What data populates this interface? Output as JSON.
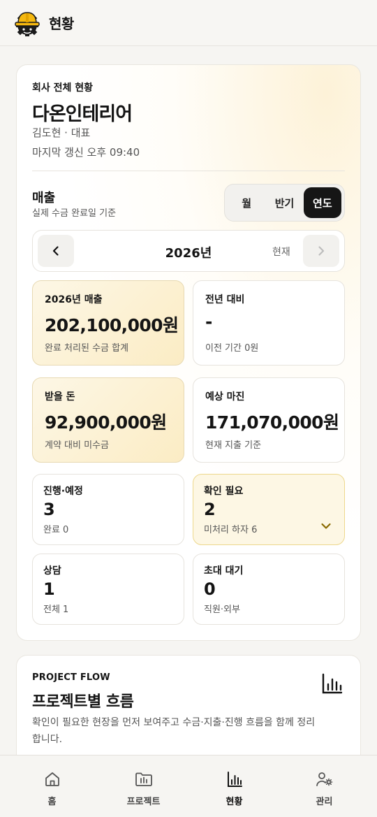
{
  "header": {
    "title": "현황",
    "logo_icon": "hardhat-gear-icon"
  },
  "overview": {
    "section_label": "회사 전체 현황",
    "company": "다온인테리어",
    "owner": "김도현 · 대표",
    "updated": "마지막 갱신 오후 09:40"
  },
  "revenue": {
    "title": "매출",
    "subtitle": "실제 수금 완료일 기준",
    "period_tabs": [
      "월",
      "반기",
      "연도"
    ],
    "active_tab": "연도",
    "year": "2026년",
    "current_label": "현재"
  },
  "stats": [
    {
      "label": "2026년 매출",
      "value": "202,100,000원",
      "sub": "완료 처리된 수금 합계"
    },
    {
      "label": "전년 대비",
      "value": "-",
      "sub": "이전 기간 0원"
    },
    {
      "label": "받을 돈",
      "value": "92,900,000원",
      "sub": "계약 대비 미수금"
    },
    {
      "label": "예상 마진",
      "value": "171,070,000원",
      "sub": "현재 지출 기준"
    }
  ],
  "minis": [
    {
      "label": "진행·예정",
      "value": "3",
      "sub": "완료 0"
    },
    {
      "label": "확인 필요",
      "value": "2",
      "sub": "미처리 하자 6"
    },
    {
      "label": "상담",
      "value": "1",
      "sub": "전체 1"
    },
    {
      "label": "초대 대기",
      "value": "0",
      "sub": "직원·외부"
    }
  ],
  "project_flow": {
    "kicker": "PROJECT FLOW",
    "title": "프로젝트별 흐름",
    "description": "확인이 필요한 현장을 먼저 보여주고 수금·지출·진행 흐름을 함께 정리합니다."
  },
  "bottom_nav": [
    {
      "label": "홈",
      "icon": "home-icon"
    },
    {
      "label": "프로젝트",
      "icon": "folder-chart-icon"
    },
    {
      "label": "현황",
      "icon": "bar-chart-icon"
    },
    {
      "label": "관리",
      "icon": "user-gear-icon"
    }
  ],
  "colors": {
    "accent_gold": "#fbecc4",
    "active_tab": "#161616",
    "chevron": "#8a6a00"
  }
}
